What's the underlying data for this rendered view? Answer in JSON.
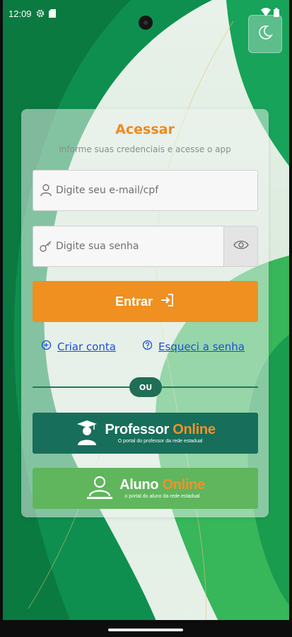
{
  "status_bar": {
    "time": "12:09",
    "icons": [
      "gear-icon",
      "sd-card-icon",
      "wifi-icon",
      "battery-icon"
    ]
  },
  "theme_toggle": {
    "icon": "moon-icon"
  },
  "login": {
    "title": "Acessar",
    "subtitle": "Informe suas credenciais e acesse o app",
    "email_placeholder": "Digite seu e-mail/cpf",
    "password_placeholder": "Digite sua senha",
    "submit_label": "Entrar",
    "create_account": "Criar conta",
    "forgot_password": "Esqueci a senha",
    "divider": "OU"
  },
  "portals": {
    "professor": {
      "name_part1": "Professor",
      "name_part2": "Online",
      "tagline": "O portal do professor da rede estadual"
    },
    "aluno": {
      "name_part1": "Aluno",
      "name_part2": "Online",
      "tagline": "o portal do aluno da rede estadual"
    }
  },
  "colors": {
    "primary_orange": "#ef9020",
    "dark_green": "#176e5a",
    "light_green": "#5fb65d",
    "link_blue": "#1a4fd4"
  }
}
